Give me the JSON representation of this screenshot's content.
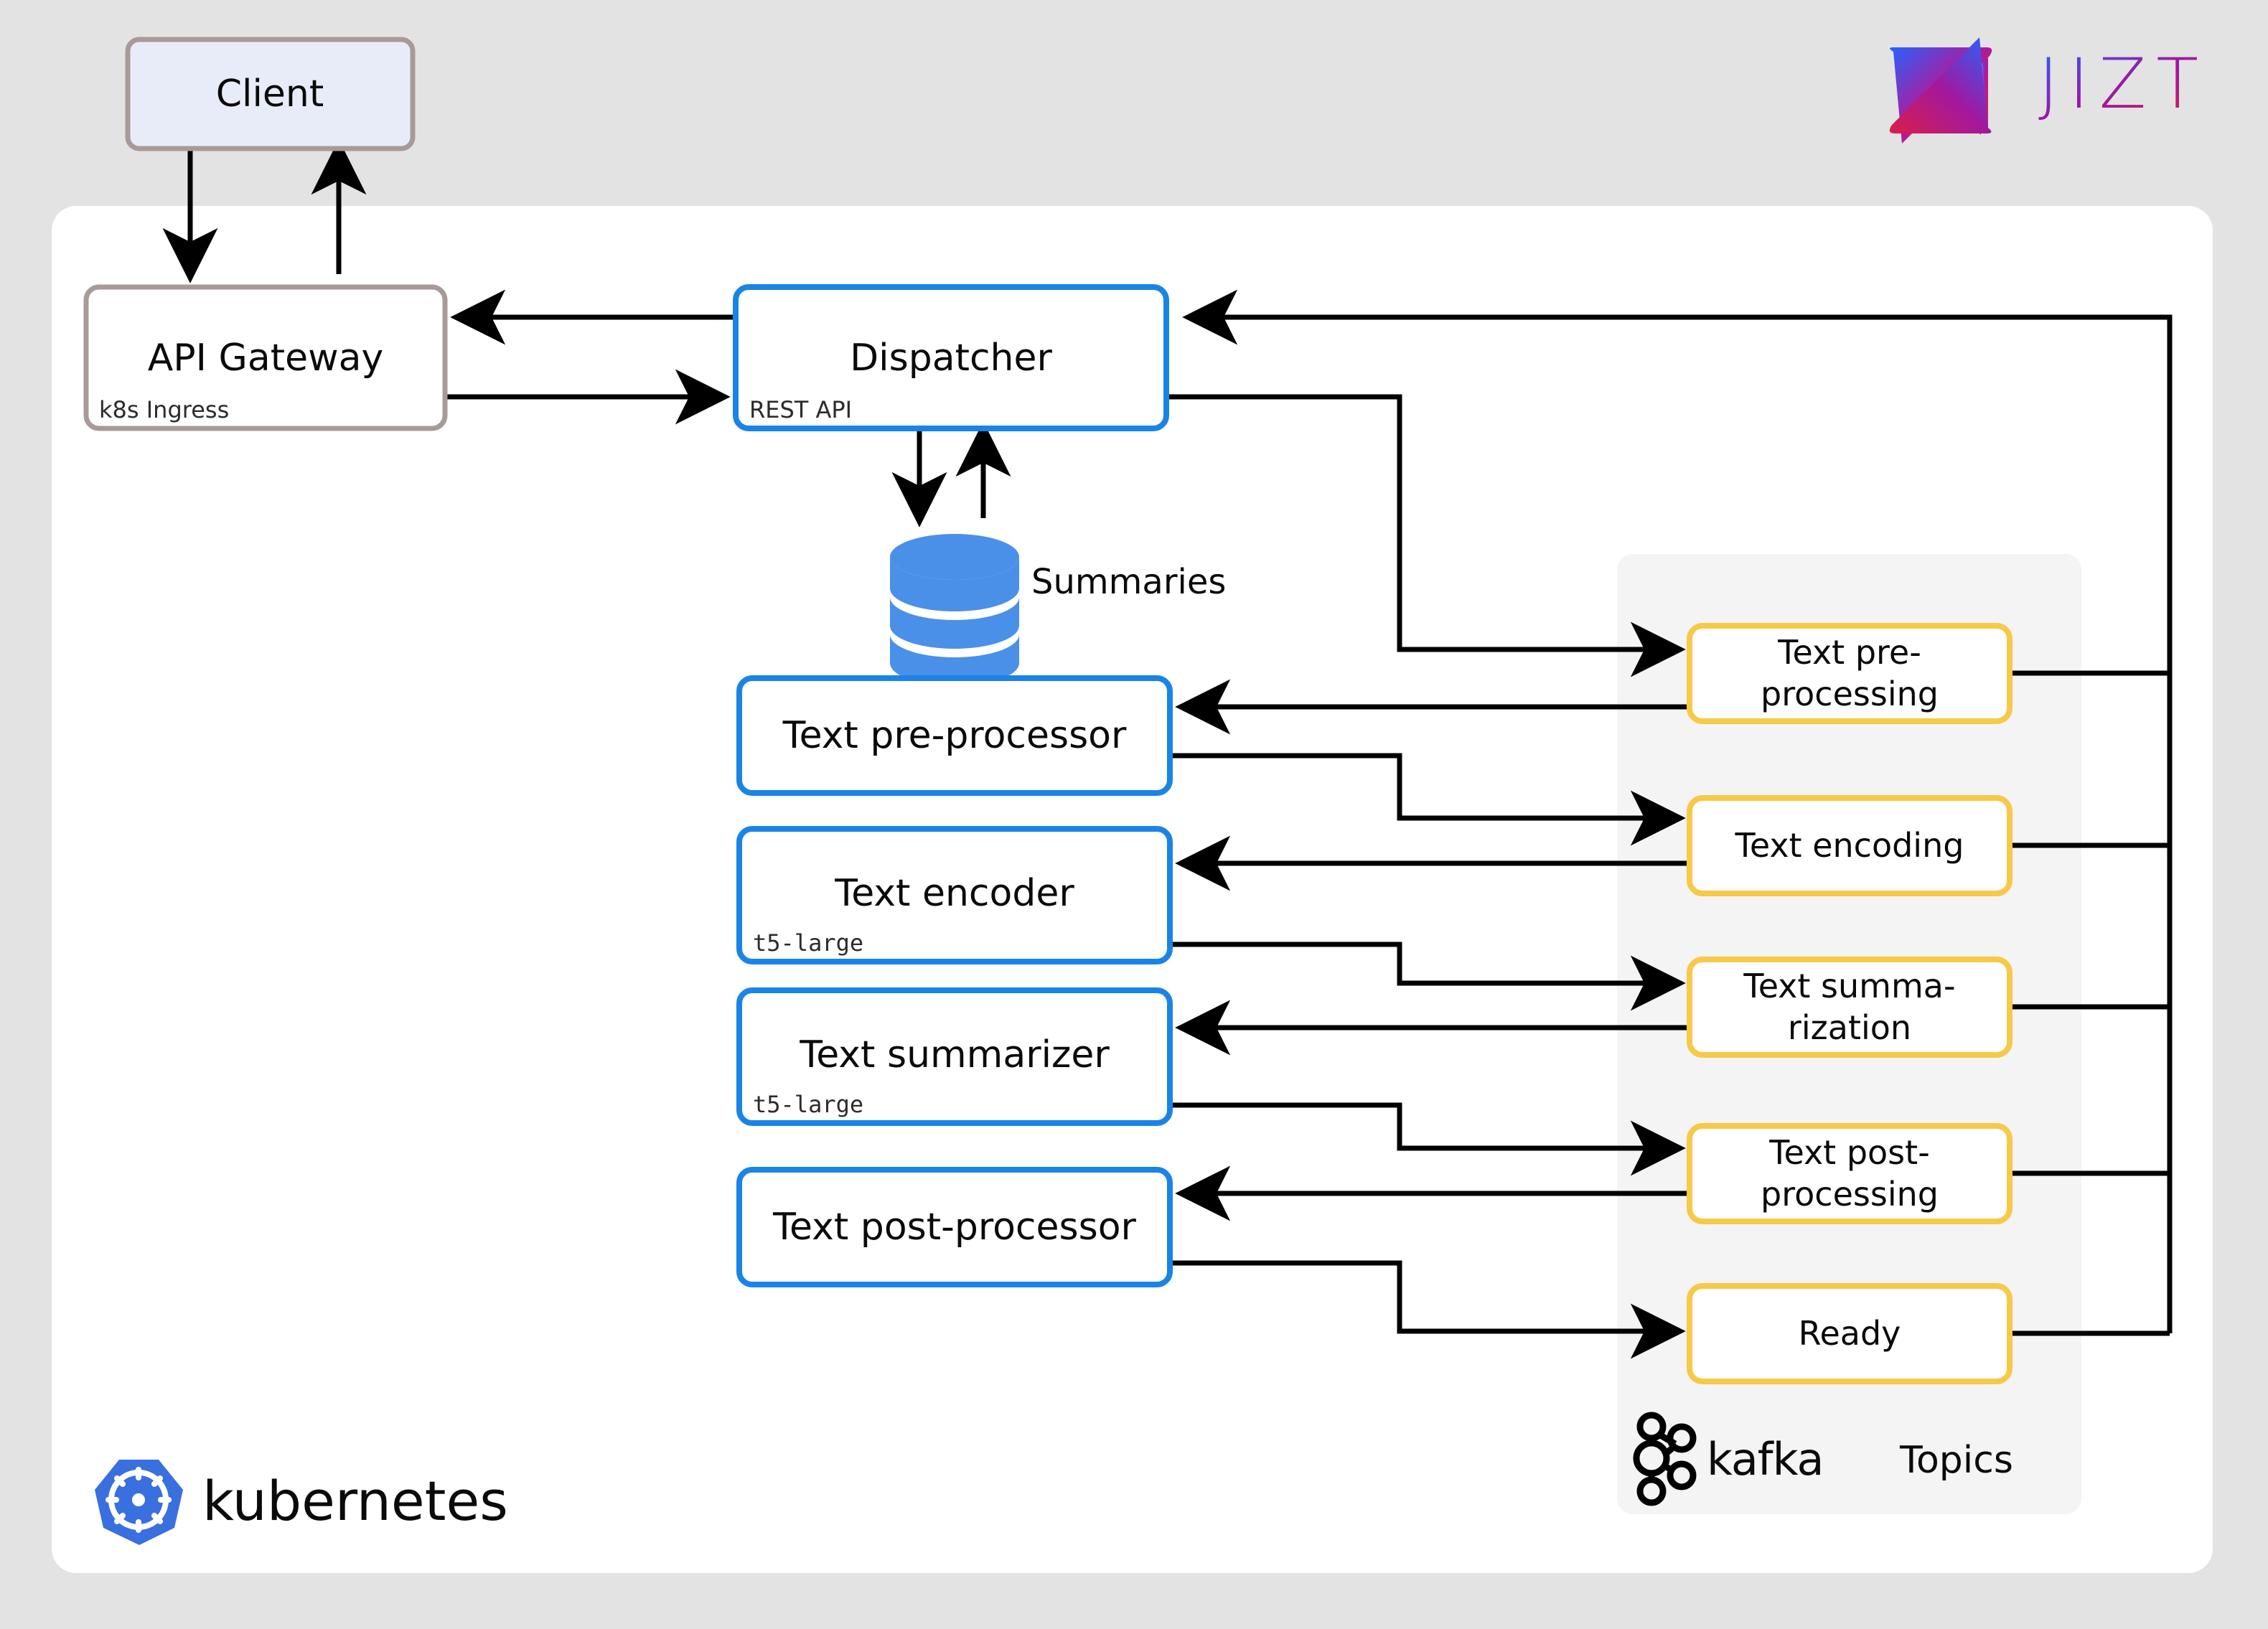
{
  "page": {
    "background_color": "#e3e3e3",
    "panel_color": "#ffffff",
    "kafka_panel_color": "#f4f4f4"
  },
  "brand": {
    "logo_text": "JIZT",
    "logo_gradient_start": "#2463ff",
    "logo_gradient_end": "#d81e49"
  },
  "cluster": {
    "platform_label": "kubernetes",
    "platform_color": "#3a6fe0"
  },
  "external": {
    "client": {
      "label": "Client",
      "fill": "#e8ecf8",
      "border": "#a89a98"
    }
  },
  "services": {
    "api_gateway": {
      "label": "API Gateway",
      "subtitle": "k8s Ingress",
      "border": "#a89a98"
    },
    "dispatcher": {
      "label": "Dispatcher",
      "subtitle": "REST API",
      "border": "#1a84e6"
    },
    "text_preprocessor": {
      "label": "Text pre-processor",
      "subtitle": "",
      "border": "#1a84e6"
    },
    "text_encoder": {
      "label": "Text encoder",
      "subtitle": "t5-large",
      "border": "#1a84e6"
    },
    "text_summarizer": {
      "label": "Text summarizer",
      "subtitle": "t5-large",
      "border": "#1a84e6"
    },
    "text_postprocessor": {
      "label": "Text post-processor",
      "subtitle": "",
      "border": "#1a84e6"
    }
  },
  "datastore": {
    "label": "Summaries",
    "color": "#4a90e8"
  },
  "kafka": {
    "brand_label": "kafka",
    "section_label": "Topics",
    "topic_border": "#f7c948",
    "topics": [
      {
        "line1": "Text pre-",
        "line2": "processing"
      },
      {
        "line1": "Text encoding",
        "line2": ""
      },
      {
        "line1": "Text summa-",
        "line2": "rization"
      },
      {
        "line1": "Text post-",
        "line2": "processing"
      },
      {
        "line1": "Ready",
        "line2": ""
      }
    ]
  }
}
